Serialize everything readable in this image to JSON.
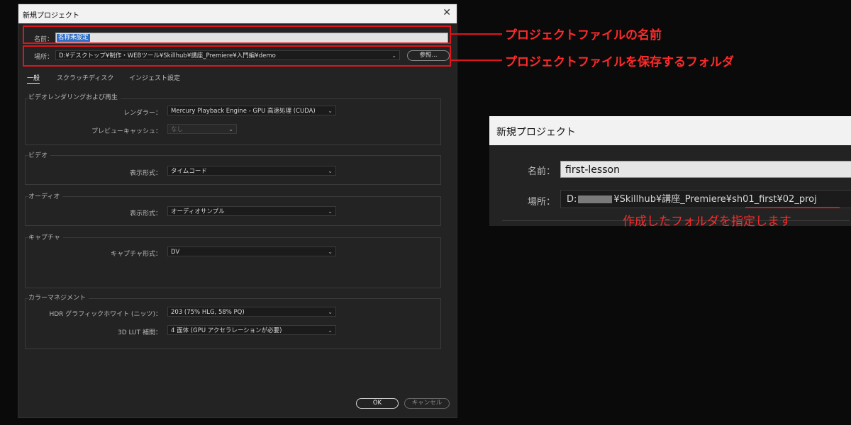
{
  "dialog": {
    "title": "新規プロジェクト",
    "close_glyph": "✕",
    "name_label": "名前：",
    "name_value": "名称未設定",
    "location_label": "場所：",
    "location_value": "D:¥デスクトップ¥制作・WEBツール¥Skillhub¥講座_Premiere¥入門編¥demo",
    "browse_label": "参照...",
    "tabs": [
      {
        "label": "一般",
        "active": true
      },
      {
        "label": "スクラッチディスク",
        "active": false
      },
      {
        "label": "インジェスト設定",
        "active": false
      }
    ],
    "groups": {
      "video_rendering": {
        "title": "ビデオレンダリングおよび再生",
        "renderer_label": "レンダラー：",
        "renderer_value": "Mercury Playback Engine - GPU 高速処理 (CUDA)",
        "preview_cache_label": "プレビューキャッシュ：",
        "preview_cache_value": "なし"
      },
      "video": {
        "title": "ビデオ",
        "display_format_label": "表示形式：",
        "display_format_value": "タイムコード"
      },
      "audio": {
        "title": "オーディオ",
        "display_format_label": "表示形式：",
        "display_format_value": "オーディオサンプル"
      },
      "capture": {
        "title": "キャプチャ",
        "format_label": "キャプチャ形式：",
        "format_value": "DV"
      },
      "color": {
        "title": "カラーマネジメント",
        "hdr_label": "HDR グラフィックホワイト (ニッツ)：",
        "hdr_value": "203 (75% HLG, 58% PQ)",
        "lut_label": "3D LUT 補間：",
        "lut_value": "4 面体 (GPU アクセラレーションが必要)"
      }
    },
    "ok_label": "OK",
    "cancel_label": "キャンセル"
  },
  "annotations": {
    "name_note": "プロジェクトファイルの名前",
    "location_note": "プロジェクトファイルを保存するフォルダ",
    "folder_note": "作成したフォルダを指定します",
    "accent_color": "#e0141c"
  },
  "zoom": {
    "title": "新規プロジェクト",
    "name_label": "名前：",
    "name_value": "first-lesson",
    "location_label": "場所：",
    "location_prefix": "D:",
    "location_visible": "¥Skillhub¥講座_Premiere¥",
    "location_highlight": "sh01_first¥02_proj"
  },
  "icons": {
    "chevron": "chevron-down-icon",
    "close": "close-icon"
  }
}
